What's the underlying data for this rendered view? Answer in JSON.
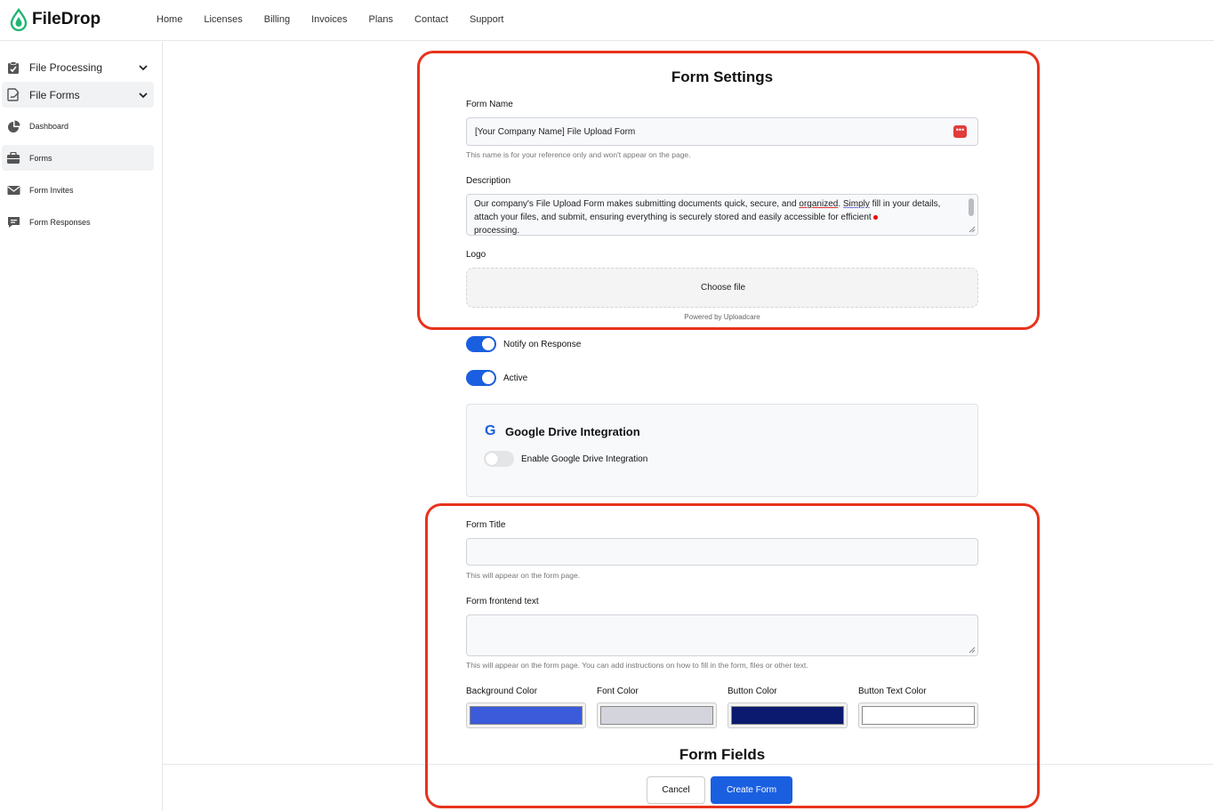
{
  "app": {
    "name": "FileDrop"
  },
  "topnav": [
    "Home",
    "Licenses",
    "Billing",
    "Invoices",
    "Plans",
    "Contact",
    "Support"
  ],
  "sidebar": {
    "items": [
      {
        "label": "File Processing",
        "icon": "clipboard-check-icon"
      },
      {
        "label": "File Forms",
        "icon": "file-signature-icon"
      },
      {
        "label": "Dashboard",
        "icon": "pie-chart-icon"
      },
      {
        "label": "Forms",
        "icon": "briefcase-icon"
      },
      {
        "label": "Form Invites",
        "icon": "envelope-icon"
      },
      {
        "label": "Form Responses",
        "icon": "comment-icon"
      }
    ]
  },
  "settings": {
    "title": "Form Settings",
    "form_name_label": "Form Name",
    "form_name_value": "[Your Company Name] File Upload Form",
    "form_name_help": "This name is for your reference only and won't appear on the page.",
    "description_label": "Description",
    "description_part1": "Our company's File Upload Form makes submitting documents quick, secure, and ",
    "description_word1": "organized",
    "description_part2": ". ",
    "description_word2": "Simply",
    "description_part3": " fill in your details, attach your files, and submit, ensuring everything is securely stored and easily accessible for efficient",
    "description_part4": "processing.",
    "logo_label": "Logo",
    "choose_file": "Choose file",
    "powered_by": "Powered by Uploadcare",
    "notify_label": "Notify on Response",
    "notify_on": true,
    "active_label": "Active",
    "active_on": true
  },
  "google_drive": {
    "icon": "G",
    "title": "Google Drive Integration",
    "toggle_label": "Enable Google Drive Integration",
    "enabled": false
  },
  "frontend": {
    "form_title_label": "Form Title",
    "form_title_value": "",
    "form_title_help": "This will appear on the form page.",
    "frontend_text_label": "Form frontend text",
    "frontend_text_value": "",
    "frontend_text_help": "This will appear on the form page. You can add instructions on how to fill in the form, files or other text.",
    "colors": [
      {
        "label": "Background Color",
        "value": "#3b5bdb"
      },
      {
        "label": "Font Color",
        "value": "#d4d4dc"
      },
      {
        "label": "Button Color",
        "value": "#0b1a6e"
      },
      {
        "label": "Button Text Color",
        "value": "#ffffff"
      }
    ],
    "fields_title": "Form Fields"
  },
  "footer": {
    "cancel": "Cancel",
    "create": "Create Form"
  },
  "annotation_color": "#e8321c"
}
